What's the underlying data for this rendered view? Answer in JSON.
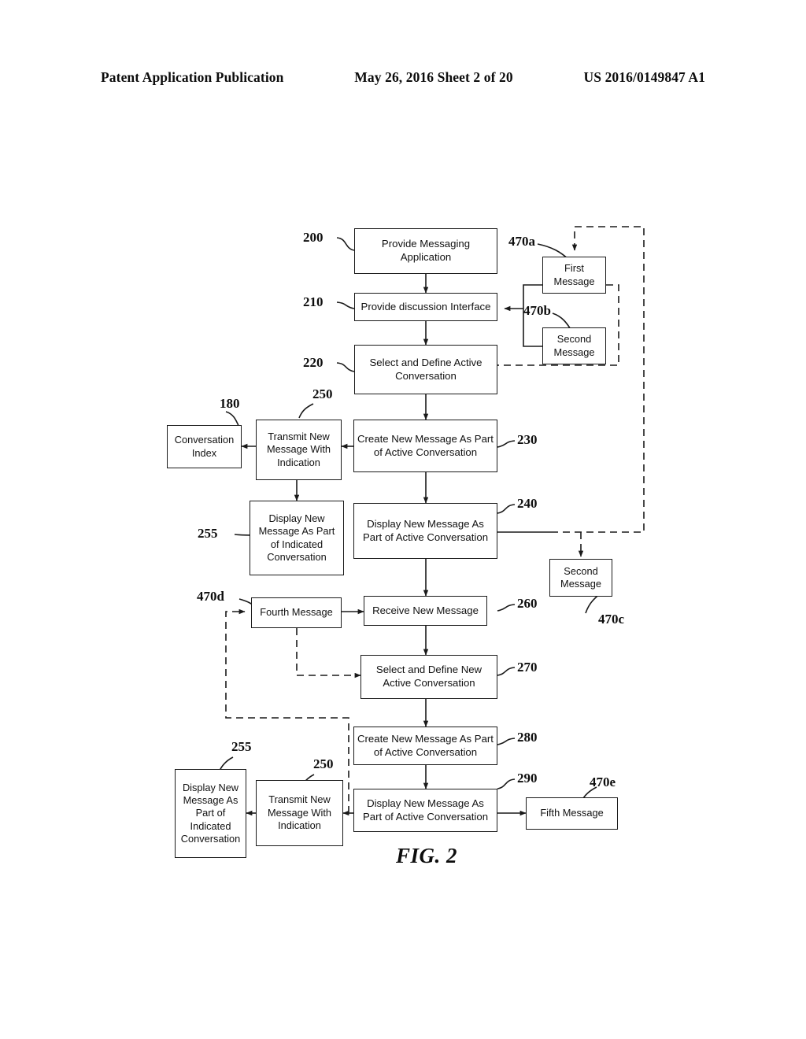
{
  "header": {
    "left": "Patent Application Publication",
    "middle": "May 26, 2016  Sheet 2 of 20",
    "right": "US 2016/0149847 A1"
  },
  "figure": {
    "caption": "FIG. 2",
    "nodes": [
      {
        "id": "n200",
        "ref": "200",
        "label": "Provide Messaging Application"
      },
      {
        "id": "n210",
        "ref": "210",
        "label": "Provide discussion Interface"
      },
      {
        "id": "n220",
        "ref": "220",
        "label": "Select and Define Active Conversation"
      },
      {
        "id": "n230",
        "ref": "230",
        "label": "Create New Message As Part of Active Conversation"
      },
      {
        "id": "n240",
        "ref": "240",
        "label": "Display New Message As Part of Active Conversation"
      },
      {
        "id": "n250a",
        "ref": "250",
        "label": "Transmit New Message With Indication"
      },
      {
        "id": "n255a",
        "ref": "255",
        "label": "Display New Message As Part of Indicated Conversation"
      },
      {
        "id": "n180",
        "ref": "180",
        "label": "Conversation Index"
      },
      {
        "id": "n260",
        "ref": "260",
        "label": "Receive New Message"
      },
      {
        "id": "n270",
        "ref": "270",
        "label": "Select and Define New Active Conversation"
      },
      {
        "id": "n280",
        "ref": "280",
        "label": "Create New Message As Part of Active Conversation"
      },
      {
        "id": "n290",
        "ref": "290",
        "label": "Display New Message As Part of Active Conversation"
      },
      {
        "id": "n250b",
        "ref": "250",
        "label": "Transmit New Message With Indication"
      },
      {
        "id": "n255b",
        "ref": "255",
        "label": "Display New Message As Part of Indicated Conversation"
      },
      {
        "id": "m470a",
        "ref": "470a",
        "label": "First Message"
      },
      {
        "id": "m470b",
        "ref": "470b",
        "label": "Second Message"
      },
      {
        "id": "m470c",
        "ref": "470c",
        "label": "Second Message"
      },
      {
        "id": "m470d",
        "ref": "470d",
        "label": "Fourth Message"
      },
      {
        "id": "m470e",
        "ref": "470e",
        "label": "Fifth Message"
      }
    ]
  }
}
